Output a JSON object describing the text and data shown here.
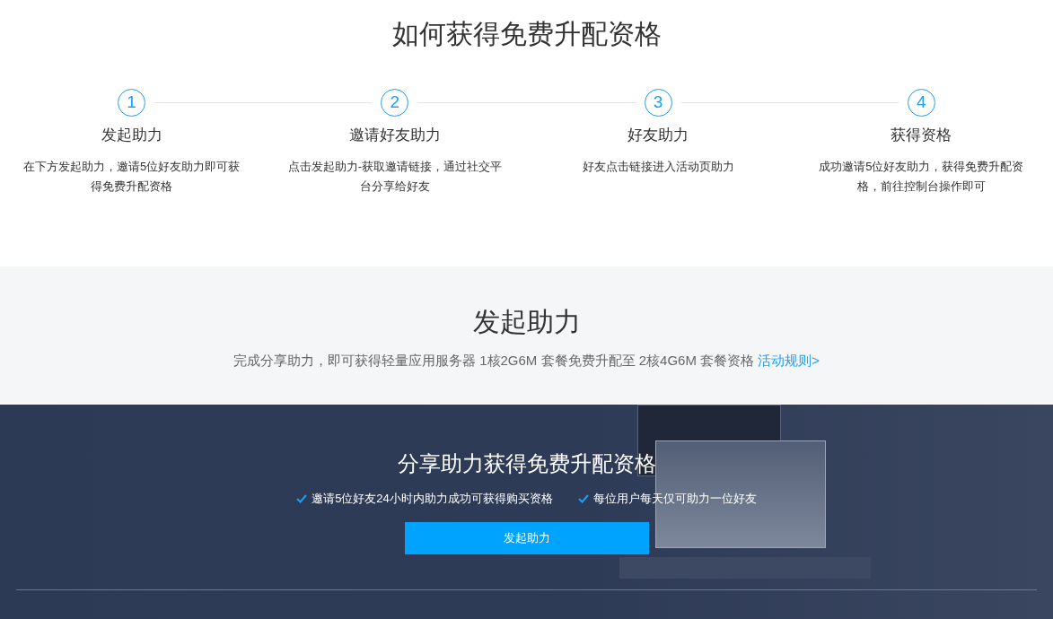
{
  "title": "如何获得免费升配资格",
  "steps": [
    {
      "number": "1",
      "title": "发起助力",
      "description": "在下方发起助力，邀请5位好友助力即可获得免费升配资格"
    },
    {
      "number": "2",
      "title": "邀请好友助力",
      "description": "点击发起助力-获取邀请链接，通过社交平台分享给好友"
    },
    {
      "number": "3",
      "title": "好友助力",
      "description": "好友点击链接进入活动页助力"
    },
    {
      "number": "4",
      "title": "获得资格",
      "description": "成功邀请5位好友助力，获得免费升配资格，前往控制台操作即可"
    }
  ],
  "launch_section": {
    "heading": "发起助力",
    "subtitle": "完成分享助力，即可获得轻量应用服务器 1核2G6M 套餐免费升配至 2核4G6M 套餐资格",
    "rules_link": "活动规则>"
  },
  "banner": {
    "heading": "分享助力获得免费升配资格",
    "features": [
      "邀请5位好友24小时内助力成功可获得购买资格",
      "每位用户每天仅可助力一位好友"
    ],
    "button": "发起助力"
  }
}
